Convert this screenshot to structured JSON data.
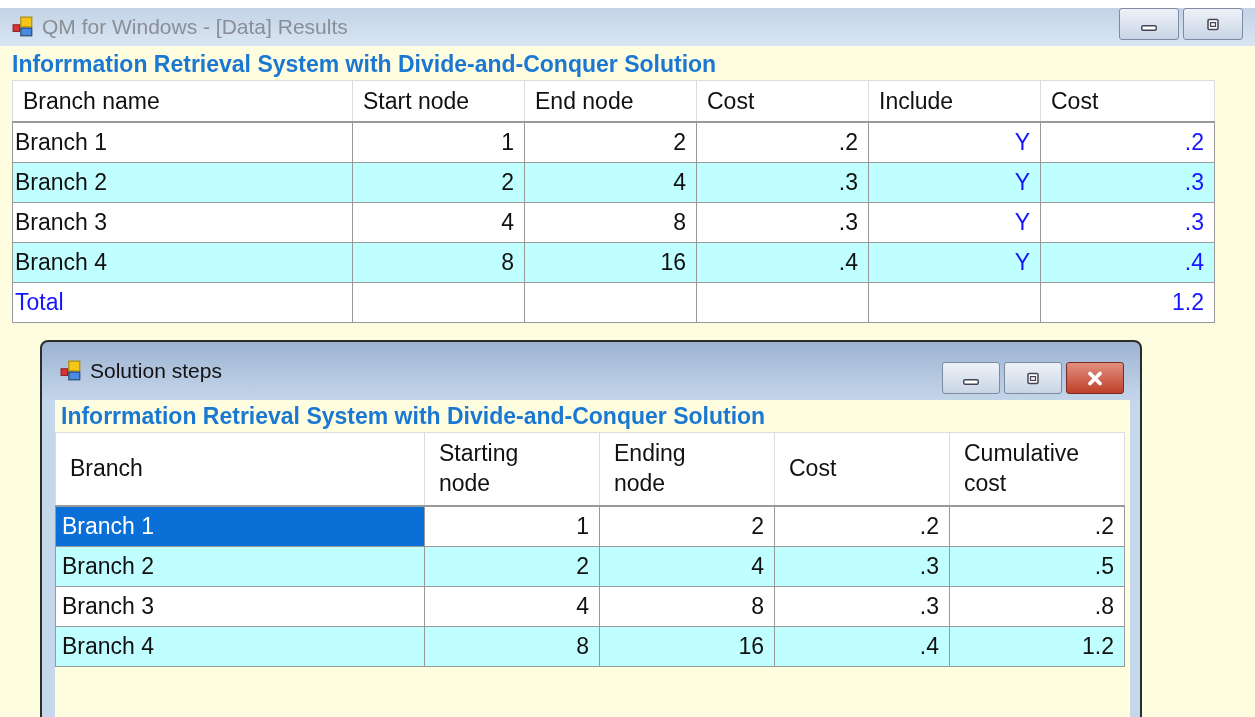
{
  "window": {
    "title": "QM for Windows - [Data] Results"
  },
  "results": {
    "heading": "Inforrmation Retrieval System with Divide-and-Conquer Solution",
    "columns": [
      {
        "label": "Branch name",
        "kind": "input"
      },
      {
        "label": "Start node",
        "kind": "input"
      },
      {
        "label": "End node",
        "kind": "input"
      },
      {
        "label": "Cost",
        "kind": "input"
      },
      {
        "label": "Include",
        "kind": "output"
      },
      {
        "label": "Cost",
        "kind": "output"
      }
    ],
    "rows": [
      {
        "kind": "data",
        "cells": [
          "Branch 1",
          "1",
          "2",
          ".2",
          "Y",
          ".2"
        ]
      },
      {
        "kind": "data",
        "cells": [
          "Branch 2",
          "2",
          "4",
          ".3",
          "Y",
          ".3"
        ]
      },
      {
        "kind": "data",
        "cells": [
          "Branch 3",
          "4",
          "8",
          ".3",
          "Y",
          ".3"
        ]
      },
      {
        "kind": "data",
        "cells": [
          "Branch 4",
          "8",
          "16",
          ".4",
          "Y",
          ".4"
        ]
      },
      {
        "kind": "total",
        "cells": [
          "Total",
          "",
          "",
          "",
          "",
          "1.2"
        ]
      }
    ]
  },
  "solution_window": {
    "title": "Solution steps",
    "heading": "Inforrmation Retrieval System with Divide-and-Conquer Solution",
    "columns": [
      "Branch",
      "Starting node",
      "Ending node",
      "Cost",
      "Cumulative cost"
    ],
    "rows": [
      {
        "selected": true,
        "cells": [
          "Branch 1",
          "1",
          "2",
          ".2",
          ".2"
        ]
      },
      {
        "selected": false,
        "cells": [
          "Branch 2",
          "2",
          "4",
          ".3",
          ".5"
        ]
      },
      {
        "selected": false,
        "cells": [
          "Branch 3",
          "4",
          "8",
          ".3",
          ".8"
        ]
      },
      {
        "selected": false,
        "cells": [
          "Branch 4",
          "8",
          "16",
          ".4",
          "1.2"
        ]
      }
    ]
  }
}
